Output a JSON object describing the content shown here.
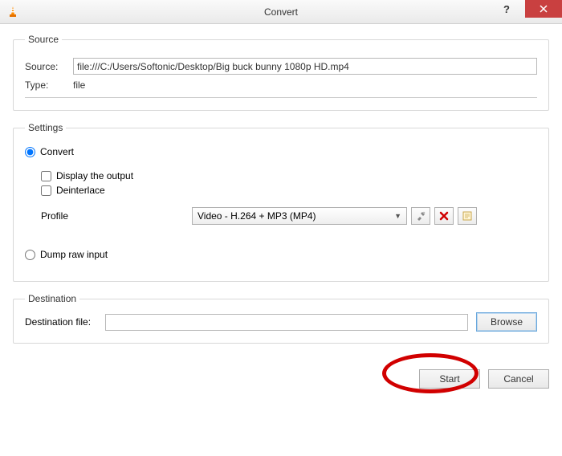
{
  "window": {
    "title": "Convert"
  },
  "source_group": {
    "legend": "Source",
    "source_label": "Source:",
    "source_value": "file:///C:/Users/Softonic/Desktop/Big buck bunny 1080p HD.mp4",
    "type_label": "Type:",
    "type_value": "file"
  },
  "settings_group": {
    "legend": "Settings",
    "convert_label": "Convert",
    "display_output_label": "Display the output",
    "deinterlace_label": "Deinterlace",
    "profile_label": "Profile",
    "profile_selected": "Video - H.264 + MP3 (MP4)",
    "dump_raw_label": "Dump raw input"
  },
  "destination_group": {
    "legend": "Destination",
    "dest_label": "Destination file:",
    "dest_value": "",
    "browse_label": "Browse"
  },
  "footer": {
    "start_label": "Start",
    "cancel_label": "Cancel"
  },
  "icons": {
    "tools": "tools-icon",
    "delete": "delete-icon",
    "new": "new-profile-icon"
  }
}
